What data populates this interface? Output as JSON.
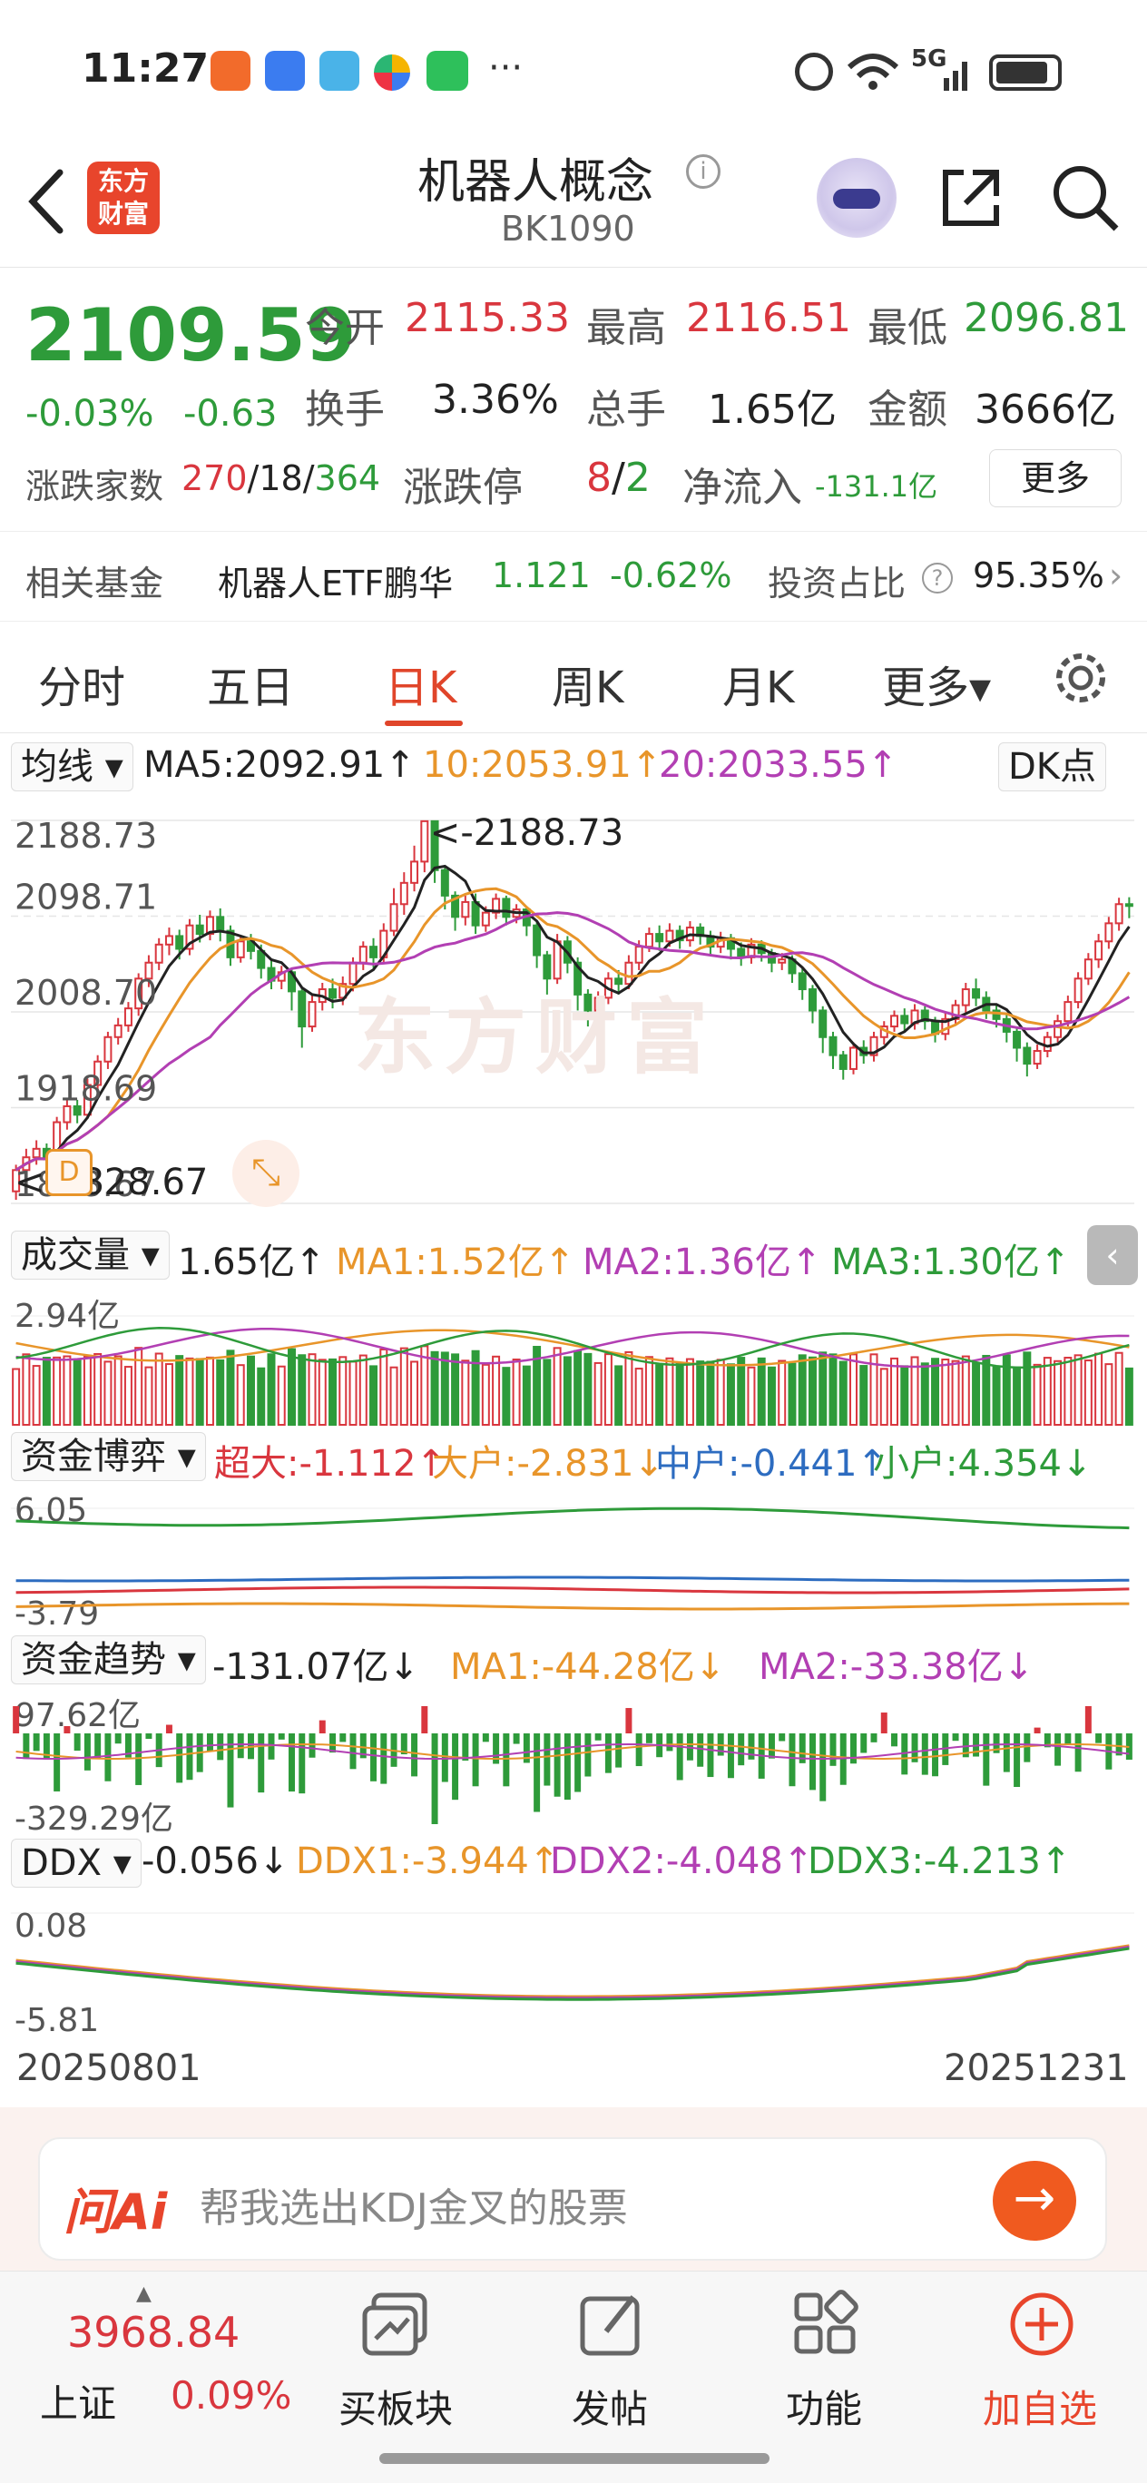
{
  "status": {
    "time": "11:27",
    "more": "···",
    "network": "5G"
  },
  "header": {
    "title": "机器人概念",
    "code": "BK1090",
    "logo_text": "东方财富"
  },
  "quote": {
    "price": "2109.59",
    "pct": "-0.03%",
    "chg": "-0.63",
    "open_label": "今开",
    "open": "2115.33",
    "high_label": "最高",
    "high": "2116.51",
    "low_label": "最低",
    "low": "2096.81",
    "turnover_label": "换手",
    "turnover": "3.36%",
    "volume_label": "总手",
    "volume": "1.65亿",
    "amount_label": "金额",
    "amount": "3666亿",
    "updown_label": "涨跌家数",
    "up": "270",
    "flat": "18",
    "down": "364",
    "limit_label": "涨跌停",
    "limit_up": "8",
    "limit_down": "2",
    "flow_label": "净流入",
    "flow": "-131.1亿",
    "more_button": "更多"
  },
  "fund": {
    "label": "相关基金",
    "name": "机器人ETF鹏华",
    "nav": "1.121",
    "pct": "-0.62%",
    "ratio_label": "投资占比",
    "ratio": "95.35%"
  },
  "tabs": [
    "分时",
    "五日",
    "日K",
    "周K",
    "月K",
    "更多▾"
  ],
  "ma_bar": {
    "selector": "均线",
    "ma5": "MA5:2092.91↑",
    "ma10": "10:2053.91↑",
    "ma20": "20:2033.55↑",
    "dk": "DK点"
  },
  "kline": {
    "levels": [
      "2188.73",
      "2098.71",
      "2008.70",
      "1918.69",
      "1828.67"
    ],
    "high_marker": "<-2188.73",
    "low_marker": "<-1828.67",
    "watermark": "东方财富"
  },
  "volume": {
    "selector": "成交量",
    "value": "1.65亿↑",
    "ma1": "MA1:1.52亿↑",
    "ma2": "MA2:1.36亿↑",
    "ma3": "MA3:1.30亿↑",
    "level": "2.94亿"
  },
  "capital_game": {
    "selector": "资金博弈",
    "super": "超大:-1.112↑",
    "large": "大户:-2.831↓",
    "mid": "中户:-0.441↑",
    "small": "小户:4.354↓",
    "top": "6.05",
    "bottom": "-3.79"
  },
  "capital_trend": {
    "selector": "资金趋势",
    "value": "-131.07亿↓",
    "ma1": "MA1:-44.28亿↓",
    "ma2": "MA2:-33.38亿↓",
    "top": "97.62亿",
    "bottom": "-329.29亿"
  },
  "ddx": {
    "selector": "DDX",
    "value": "-0.056↓",
    "ddx1": "DDX1:-3.944↑",
    "ddx2": "DDX2:-4.048↑",
    "ddx3": "DDX3:-4.213↑",
    "top": "0.08",
    "bottom": "-5.81"
  },
  "dates": {
    "start": "20250801",
    "end": "20251231"
  },
  "ai": {
    "brand": "问Ai",
    "placeholder": "帮我选出KDJ金叉的股票"
  },
  "bottom": {
    "index_value": "3968.84",
    "index_name": "上证",
    "index_pct": "0.09%",
    "items": [
      "买板块",
      "发帖",
      "功能",
      "加自选"
    ]
  },
  "colors": {
    "up": "#d9363e",
    "down": "#2e9b3a",
    "accent": "#e0452a",
    "ma5": "#222222",
    "ma10": "#e8952a",
    "ma20": "#b23fb3"
  },
  "chart_data": {
    "type": "candlestick",
    "x_start": "20250801",
    "x_end": "20251231",
    "ylim": [
      1828.67,
      2188.73
    ],
    "candles": [
      [
        1840,
        1860,
        1832,
        1865
      ],
      [
        1860,
        1872,
        1852,
        1880
      ],
      [
        1872,
        1880,
        1865,
        1888
      ],
      [
        1880,
        1870,
        1862,
        1885
      ],
      [
        1870,
        1905,
        1866,
        1910
      ],
      [
        1905,
        1920,
        1898,
        1928
      ],
      [
        1920,
        1912,
        1904,
        1926
      ],
      [
        1912,
        1940,
        1908,
        1946
      ],
      [
        1940,
        1962,
        1935,
        1968
      ],
      [
        1962,
        1985,
        1955,
        1990
      ],
      [
        1985,
        1996,
        1978,
        2003
      ],
      [
        1996,
        2012,
        1990,
        2018
      ],
      [
        2012,
        2040,
        2005,
        2045
      ],
      [
        2040,
        2055,
        2032,
        2062
      ],
      [
        2055,
        2072,
        2048,
        2078
      ],
      [
        2072,
        2080,
        2062,
        2088
      ],
      [
        2080,
        2068,
        2058,
        2086
      ],
      [
        2068,
        2090,
        2062,
        2096
      ],
      [
        2090,
        2082,
        2074,
        2100
      ],
      [
        2082,
        2098,
        2076,
        2104
      ],
      [
        2098,
        2085,
        2075,
        2106
      ],
      [
        2085,
        2060,
        2052,
        2090
      ],
      [
        2060,
        2075,
        2055,
        2080
      ],
      [
        2075,
        2066,
        2058,
        2082
      ],
      [
        2066,
        2050,
        2040,
        2072
      ],
      [
        2050,
        2038,
        2030,
        2058
      ],
      [
        2038,
        2046,
        2030,
        2052
      ],
      [
        2046,
        2028,
        2010,
        2050
      ],
      [
        2028,
        1995,
        1975,
        2032
      ],
      [
        1995,
        2018,
        1990,
        2024
      ],
      [
        2018,
        2030,
        2010,
        2036
      ],
      [
        2030,
        2022,
        2012,
        2040
      ],
      [
        2022,
        2035,
        2015,
        2042
      ],
      [
        2035,
        2055,
        2028,
        2060
      ],
      [
        2055,
        2070,
        2048,
        2075
      ],
      [
        2070,
        2060,
        2050,
        2078
      ],
      [
        2060,
        2085,
        2055,
        2092
      ],
      [
        2085,
        2110,
        2080,
        2125
      ],
      [
        2110,
        2130,
        2100,
        2140
      ],
      [
        2130,
        2150,
        2122,
        2165
      ],
      [
        2150,
        2188,
        2140,
        2188
      ],
      [
        2188,
        2142,
        2130,
        2188
      ],
      [
        2142,
        2118,
        2105,
        2146
      ],
      [
        2118,
        2098,
        2085,
        2122
      ],
      [
        2098,
        2112,
        2090,
        2118
      ],
      [
        2112,
        2090,
        2082,
        2120
      ],
      [
        2090,
        2102,
        2084,
        2108
      ],
      [
        2102,
        2115,
        2096,
        2120
      ],
      [
        2115,
        2098,
        2090,
        2118
      ],
      [
        2098,
        2105,
        2092,
        2110
      ],
      [
        2105,
        2090,
        2080,
        2108
      ],
      [
        2090,
        2062,
        2050,
        2094
      ],
      [
        2062,
        2040,
        2025,
        2066
      ],
      [
        2040,
        2075,
        2035,
        2082
      ],
      [
        2075,
        2055,
        2045,
        2080
      ],
      [
        2055,
        2025,
        2010,
        2060
      ],
      [
        2025,
        2010,
        1995,
        2030
      ],
      [
        2010,
        2022,
        2004,
        2028
      ],
      [
        2022,
        2040,
        2016,
        2046
      ],
      [
        2040,
        2035,
        2025,
        2048
      ],
      [
        2035,
        2055,
        2030,
        2062
      ],
      [
        2055,
        2070,
        2048,
        2076
      ],
      [
        2070,
        2082,
        2065,
        2088
      ],
      [
        2082,
        2075,
        2066,
        2090
      ],
      [
        2075,
        2085,
        2070,
        2092
      ],
      [
        2085,
        2076,
        2068,
        2090
      ],
      [
        2076,
        2088,
        2070,
        2094
      ],
      [
        2088,
        2080,
        2072,
        2092
      ],
      [
        2080,
        2070,
        2062,
        2085
      ],
      [
        2070,
        2078,
        2064,
        2084
      ],
      [
        2078,
        2068,
        2058,
        2082
      ],
      [
        2068,
        2060,
        2052,
        2074
      ],
      [
        2060,
        2072,
        2054,
        2078
      ],
      [
        2072,
        2064,
        2056,
        2076
      ],
      [
        2064,
        2055,
        2046,
        2068
      ],
      [
        2055,
        2058,
        2048,
        2064
      ],
      [
        2058,
        2045,
        2036,
        2062
      ],
      [
        2045,
        2030,
        2020,
        2050
      ],
      [
        2030,
        2010,
        1998,
        2034
      ],
      [
        2010,
        1985,
        1970,
        2014
      ],
      [
        1985,
        1968,
        1955,
        1990
      ],
      [
        1968,
        1955,
        1945,
        1972
      ],
      [
        1955,
        1975,
        1950,
        1980
      ],
      [
        1975,
        1968,
        1960,
        1982
      ],
      [
        1968,
        1985,
        1962,
        1990
      ],
      [
        1985,
        1995,
        1978,
        2000
      ],
      [
        1995,
        2005,
        1990,
        2010
      ],
      [
        2005,
        1998,
        1990,
        2012
      ],
      [
        1998,
        2010,
        1992,
        2016
      ],
      [
        2010,
        2000,
        1992,
        2014
      ],
      [
        2000,
        1988,
        1980,
        2004
      ],
      [
        1988,
        2002,
        1982,
        2008
      ],
      [
        2002,
        2015,
        1996,
        2020
      ],
      [
        2015,
        2030,
        2008,
        2036
      ],
      [
        2030,
        2022,
        2014,
        2040
      ],
      [
        2022,
        2010,
        2002,
        2028
      ],
      [
        2010,
        2002,
        1994,
        2016
      ],
      [
        2002,
        1990,
        1980,
        2006
      ],
      [
        1990,
        1975,
        1962,
        1994
      ],
      [
        1975,
        1960,
        1948,
        1980
      ],
      [
        1960,
        1972,
        1955,
        1978
      ],
      [
        1972,
        1985,
        1966,
        1990
      ],
      [
        1985,
        2000,
        1980,
        2006
      ],
      [
        2000,
        2018,
        1995,
        2024
      ],
      [
        2018,
        2040,
        2012,
        2046
      ],
      [
        2040,
        2058,
        2034,
        2064
      ],
      [
        2058,
        2075,
        2050,
        2082
      ],
      [
        2075,
        2092,
        2068,
        2098
      ],
      [
        2092,
        2110,
        2085,
        2116
      ],
      [
        2110,
        2109.59,
        2096.81,
        2116.51
      ]
    ]
  }
}
